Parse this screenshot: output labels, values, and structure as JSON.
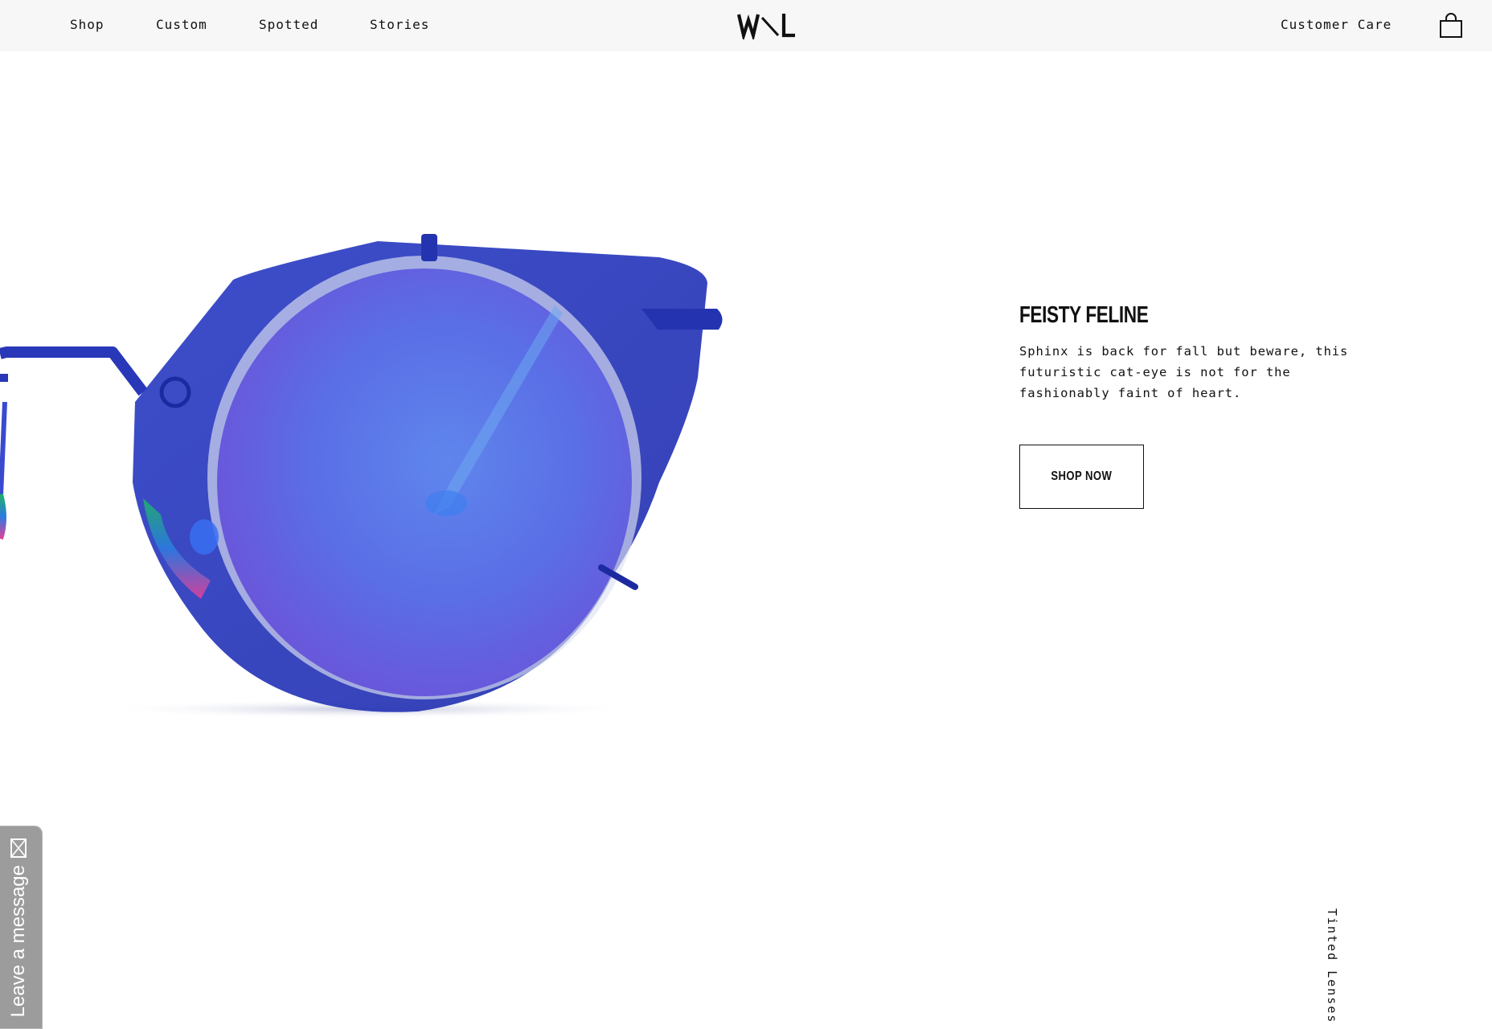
{
  "header": {
    "nav": [
      {
        "label": "Shop"
      },
      {
        "label": "Custom"
      },
      {
        "label": "Spotted"
      },
      {
        "label": "Stories"
      }
    ],
    "logo_text": "W\\L",
    "customer_care": "Customer Care",
    "cart_icon": "shopping-bag-icon"
  },
  "hero": {
    "image": "blue-mirrored-cat-eye-sunglasses",
    "title": "FEISTY FELINE",
    "description": "Sphinx is back for fall but beware, this futuristic cat-eye is not for the fashionably faint of heart.",
    "cta_label": "SHOP NOW"
  },
  "collection_label": "Tinted Lenses",
  "feedback_tab": {
    "label": "Leave a message",
    "icon": "envelope-icon"
  },
  "colors": {
    "header_bg": "#f7f7f8",
    "frame_blue": "#2f3fc2",
    "lens_violet": "#6a5ae0",
    "tab_gray": "#9c9c9c"
  }
}
